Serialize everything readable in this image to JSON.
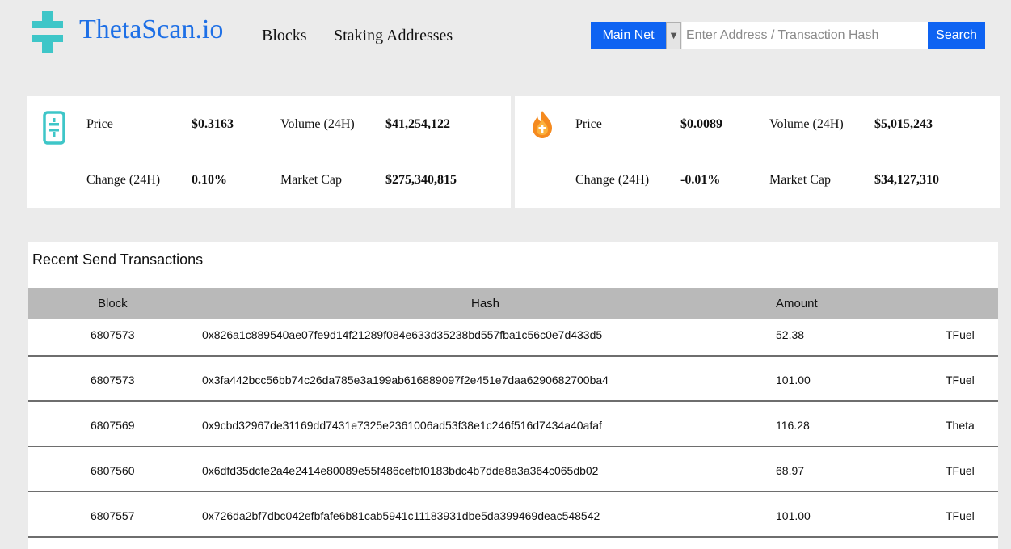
{
  "header": {
    "brand": "ThetaScan.io",
    "nav": [
      "Blocks",
      "Staking Addresses"
    ],
    "network_selected": "Main Net",
    "search_placeholder": "Enter Address / Transaction Hash",
    "search_label": "Search",
    "colors": {
      "brand": "#1d6fe6",
      "accent": "#0e63f2",
      "logo": "#3ec6c8"
    }
  },
  "theta_card": {
    "icon": "theta-logo-icon",
    "price_label": "Price",
    "price": "$0.3163",
    "volume_label": "Volume (24H)",
    "volume": "$41,254,122",
    "change_label": "Change (24H)",
    "change": "0.10%",
    "mcap_label": "Market Cap",
    "mcap": "$275,340,815"
  },
  "tfuel_card": {
    "icon": "tfuel-flame-icon",
    "price_label": "Price",
    "price": "$0.0089",
    "volume_label": "Volume (24H)",
    "volume": "$5,015,243",
    "change_label": "Change (24H)",
    "change": "-0.01%",
    "mcap_label": "Market Cap",
    "mcap": "$34,127,310"
  },
  "transactions": {
    "title": "Recent Send Transactions",
    "columns": {
      "block": "Block",
      "hash": "Hash",
      "amount": "Amount"
    },
    "rows": [
      {
        "block": "6807573",
        "hash": "0x826a1c889540ae07fe9d14f21289f084e633d35238bd557fba1c56c0e7d433d5",
        "amount": "52.38",
        "currency": "TFuel"
      },
      {
        "block": "6807573",
        "hash": "0x3fa442bcc56bb74c26da785e3a199ab616889097f2e451e7daa6290682700ba4",
        "amount": "101.00",
        "currency": "TFuel"
      },
      {
        "block": "6807569",
        "hash": "0x9cbd32967de31169dd7431e7325e2361006ad53f38e1c246f516d7434a40afaf",
        "amount": "116.28",
        "currency": "Theta"
      },
      {
        "block": "6807560",
        "hash": "0x6dfd35dcfe2a4e2414e80089e55f486cefbf0183bdc4b7dde8a3a364c065db02",
        "amount": "68.97",
        "currency": "TFuel"
      },
      {
        "block": "6807557",
        "hash": "0x726da2bf7dbc042efbfafe6b81cab5941c11183931dbe5da399469deac548542",
        "amount": "101.00",
        "currency": "TFuel"
      }
    ]
  }
}
